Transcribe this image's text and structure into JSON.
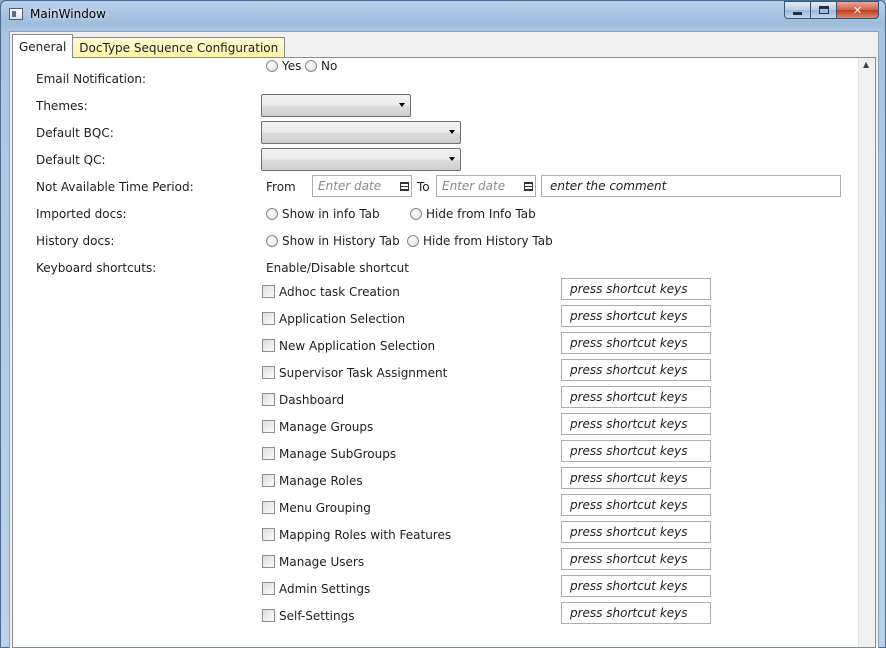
{
  "window": {
    "title": "MainWindow"
  },
  "tabs": [
    {
      "label": "General",
      "active": true
    },
    {
      "label": "DocType Sequence Configuration",
      "active": false
    }
  ],
  "form": {
    "email_notification": {
      "label": "Email Notification:",
      "yes": "Yes",
      "no": "No"
    },
    "themes": {
      "label": "Themes:",
      "value": ""
    },
    "default_bqc": {
      "label": "Default BQC:",
      "value": ""
    },
    "default_qc": {
      "label": "Default QC:",
      "value": ""
    },
    "not_available": {
      "label": "Not Available Time Period:",
      "from_label": "From",
      "to_label": "To",
      "from_placeholder": "Enter date",
      "to_placeholder": "Enter date",
      "comment_placeholder": "enter the comment"
    },
    "imported_docs": {
      "label": "Imported docs:",
      "option1": "Show in info Tab",
      "option2": "Hide from Info Tab"
    },
    "history_docs": {
      "label": "History docs:",
      "option1": "Show in History Tab",
      "option2": "Hide from History Tab"
    },
    "keyboard_shortcuts": {
      "label": "Keyboard shortcuts:",
      "header": "Enable/Disable shortcut",
      "input_placeholder": "press shortcut keys",
      "items": [
        "Adhoc task Creation",
        "Application Selection",
        "New Application Selection",
        "Supervisor Task Assignment",
        "Dashboard",
        "Manage Groups",
        "Manage SubGroups",
        "Manage Roles",
        "Menu Grouping",
        "Mapping Roles with Features",
        "Manage Users",
        "Admin Settings",
        "Self-Settings"
      ]
    }
  }
}
